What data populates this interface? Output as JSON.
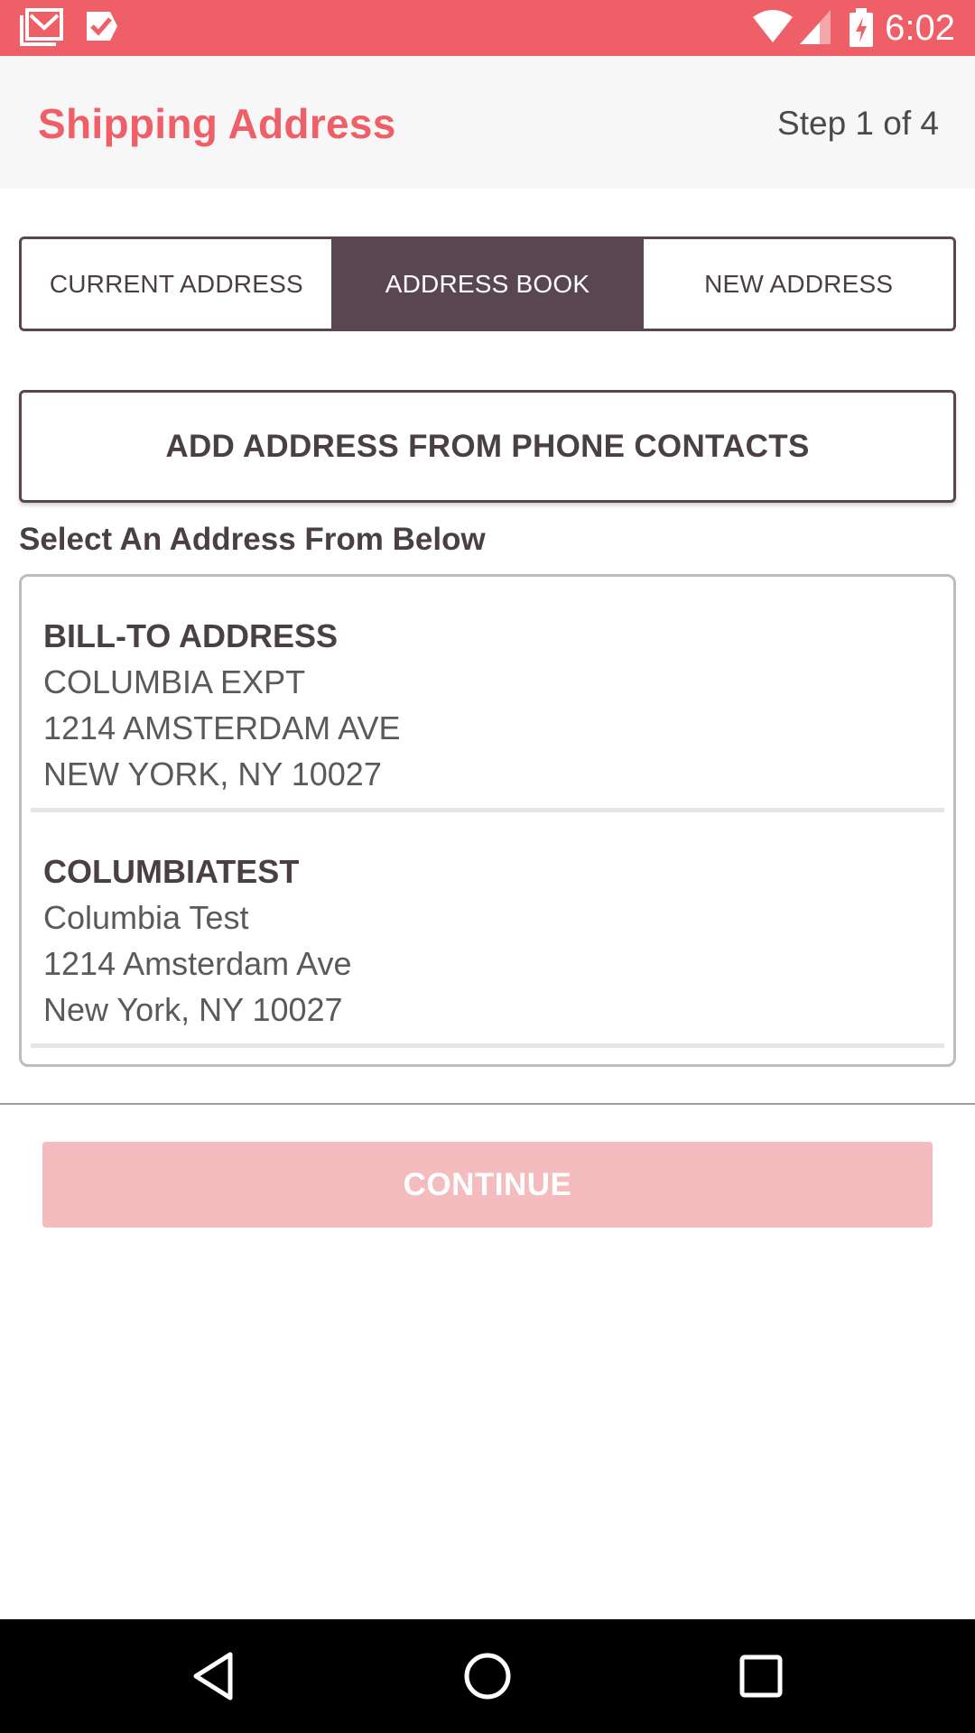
{
  "status_bar": {
    "time": "6:02",
    "left_icons": [
      "gmail-icon",
      "task-check-icon"
    ],
    "right_icons": [
      "wifi-icon",
      "signal-icon",
      "battery-charging-icon"
    ]
  },
  "app_bar": {
    "title": "Shipping Address",
    "step": "Step 1 of 4"
  },
  "tabs": [
    {
      "label": "CURRENT ADDRESS",
      "active": false
    },
    {
      "label": "ADDRESS BOOK",
      "active": true
    },
    {
      "label": "NEW ADDRESS",
      "active": false
    }
  ],
  "add_contacts_label": "ADD ADDRESS FROM PHONE CONTACTS",
  "section_label": "Select An Address From Below",
  "addresses": [
    {
      "name": "BILL-TO ADDRESS",
      "line1": "COLUMBIA EXPT",
      "line2": "1214 AMSTERDAM AVE",
      "line3": "NEW YORK, NY 10027"
    },
    {
      "name": "COLUMBIATEST",
      "line1": "Columbia Test",
      "line2": "1214 Amsterdam Ave",
      "line3": "New York, NY 10027"
    }
  ],
  "continue_label": "CONTINUE",
  "nav_bar": {
    "icons": [
      "back-icon",
      "home-icon",
      "recents-icon"
    ]
  },
  "colors": {
    "accent": "#ee5f67",
    "tab_active": "#5a4650",
    "continue_disabled": "#f5bcbf"
  }
}
